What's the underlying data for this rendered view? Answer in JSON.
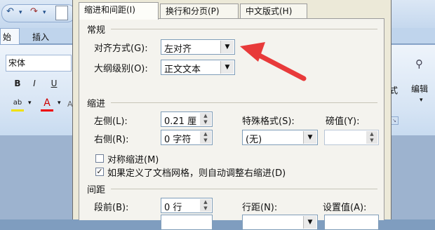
{
  "ribbon": {
    "tab_start": "始",
    "tab_insert": "插入",
    "font_name": "宋体",
    "bold": "B",
    "italic": "I",
    "underline": "U",
    "highlight": "ab",
    "font_color": "A",
    "style_label": "式",
    "edit_label": "编辑"
  },
  "dialog": {
    "tabs": [
      {
        "label": "缩进和间距(I)"
      },
      {
        "label": "换行和分页(P)"
      },
      {
        "label": "中文版式(H)"
      }
    ],
    "general": {
      "title": "常规",
      "alignment_label": "对齐方式(G):",
      "alignment_value": "左对齐",
      "outline_label": "大纲级别(O):",
      "outline_value": "正文文本"
    },
    "indent": {
      "title": "缩进",
      "left_label": "左侧(L):",
      "left_value": "0.21 厘",
      "right_label": "右侧(R):",
      "right_value": "0 字符",
      "special_label": "特殊格式(S):",
      "special_value": "(无)",
      "by_label": "磅值(Y):",
      "by_value": "",
      "mirror_label": "对称缩进(M)",
      "mirror_checked": false,
      "grid_label": "如果定义了文档网格，则自动调整右缩进(D)",
      "grid_checked": true
    },
    "spacing": {
      "title": "间距",
      "before_label": "段前(B):",
      "before_value": "0 行",
      "line_label": "行距(N):",
      "at_label": "设置值(A):"
    }
  },
  "colors": {
    "arrow": "#e83a3a",
    "dialog_bg": "#ece9d8",
    "ribbon_bg": "#dbe7f5"
  }
}
